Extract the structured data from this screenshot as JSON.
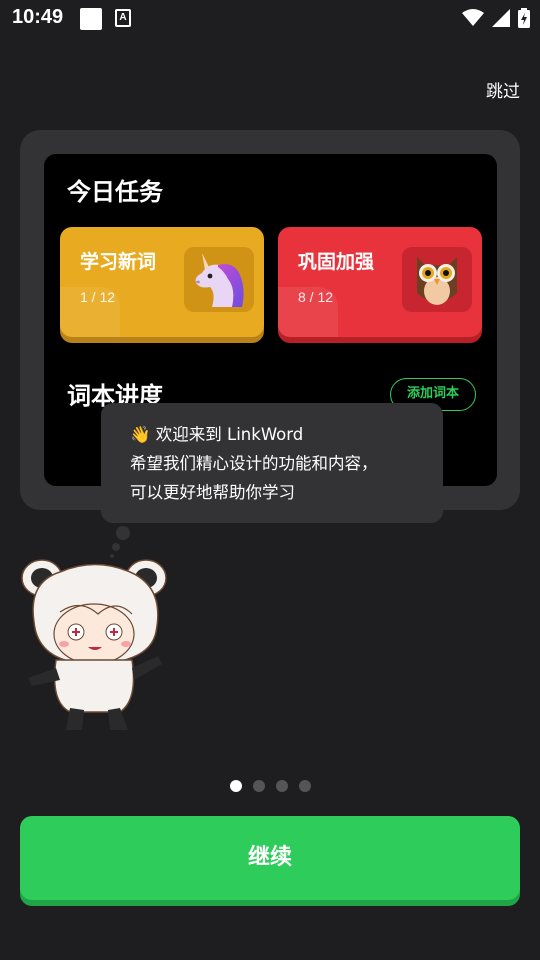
{
  "status_bar": {
    "time": "10:49",
    "notification_badge": "A"
  },
  "skip_label": "跳过",
  "today": {
    "title": "今日任务",
    "tasks": [
      {
        "title": "学习新词",
        "count": "1 / 12",
        "icon": "unicorn-icon",
        "color": "#e8aa20"
      },
      {
        "title": "巩固加强",
        "count": "8 / 12",
        "icon": "owl-icon",
        "color": "#e8333d"
      }
    ]
  },
  "wordbook": {
    "title": "词本讲度",
    "add_button": "添加词本"
  },
  "tooltip": {
    "line1": "👋 欢迎来到 LinkWord",
    "line2": "希望我们精心设计的功能和内容，",
    "line3": "可以更好地帮助你学习"
  },
  "pagination": {
    "total": 4,
    "active": 1
  },
  "continue_label": "继续",
  "colors": {
    "accent": "#2ecc5a",
    "background": "#1e1e20",
    "panel": "#333335"
  }
}
